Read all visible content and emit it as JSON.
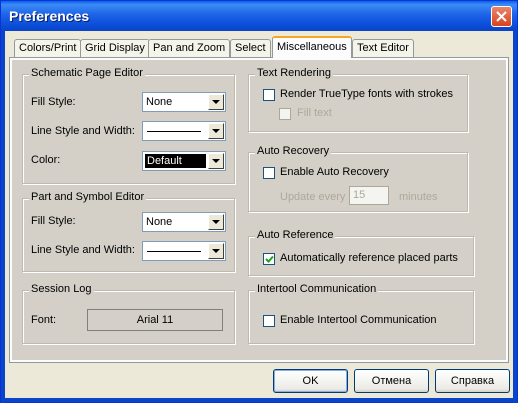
{
  "window": {
    "title": "Preferences",
    "accent": "#0A44C8"
  },
  "tabs": [
    {
      "label": "Colors/Print"
    },
    {
      "label": "Grid Display"
    },
    {
      "label": "Pan and Zoom"
    },
    {
      "label": "Select"
    },
    {
      "label": "Miscellaneous",
      "active": true
    },
    {
      "label": "Text Editor"
    }
  ],
  "schematic": {
    "title": "Schematic Page Editor",
    "fill_label": "Fill Style:",
    "fill_value": "None",
    "line_label": "Line Style and Width:",
    "color_label": "Color:",
    "color_value": "Default"
  },
  "part": {
    "title": "Part and Symbol Editor",
    "fill_label": "Fill Style:",
    "fill_value": "None",
    "line_label": "Line Style and Width:"
  },
  "session": {
    "title": "Session Log",
    "font_label": "Font:",
    "font_value": "Arial 11"
  },
  "text_rendering": {
    "title": "Text Rendering",
    "render_label": "Render TrueType fonts with strokes",
    "render_checked": false,
    "fill_text_label": "Fill text",
    "fill_text_checked": false
  },
  "auto_recovery": {
    "title": "Auto Recovery",
    "enable_label": "Enable Auto Recovery",
    "enable_checked": false,
    "update_label": "Update every",
    "update_value": "15",
    "minutes_label": "minutes"
  },
  "auto_reference": {
    "title": "Auto Reference",
    "label": "Automatically reference placed parts",
    "checked": true
  },
  "intertool": {
    "title": "Intertool Communication",
    "label": "Enable Intertool Communication",
    "checked": false
  },
  "buttons": {
    "ok": "OK",
    "cancel": "Отмена",
    "help": "Справка"
  }
}
